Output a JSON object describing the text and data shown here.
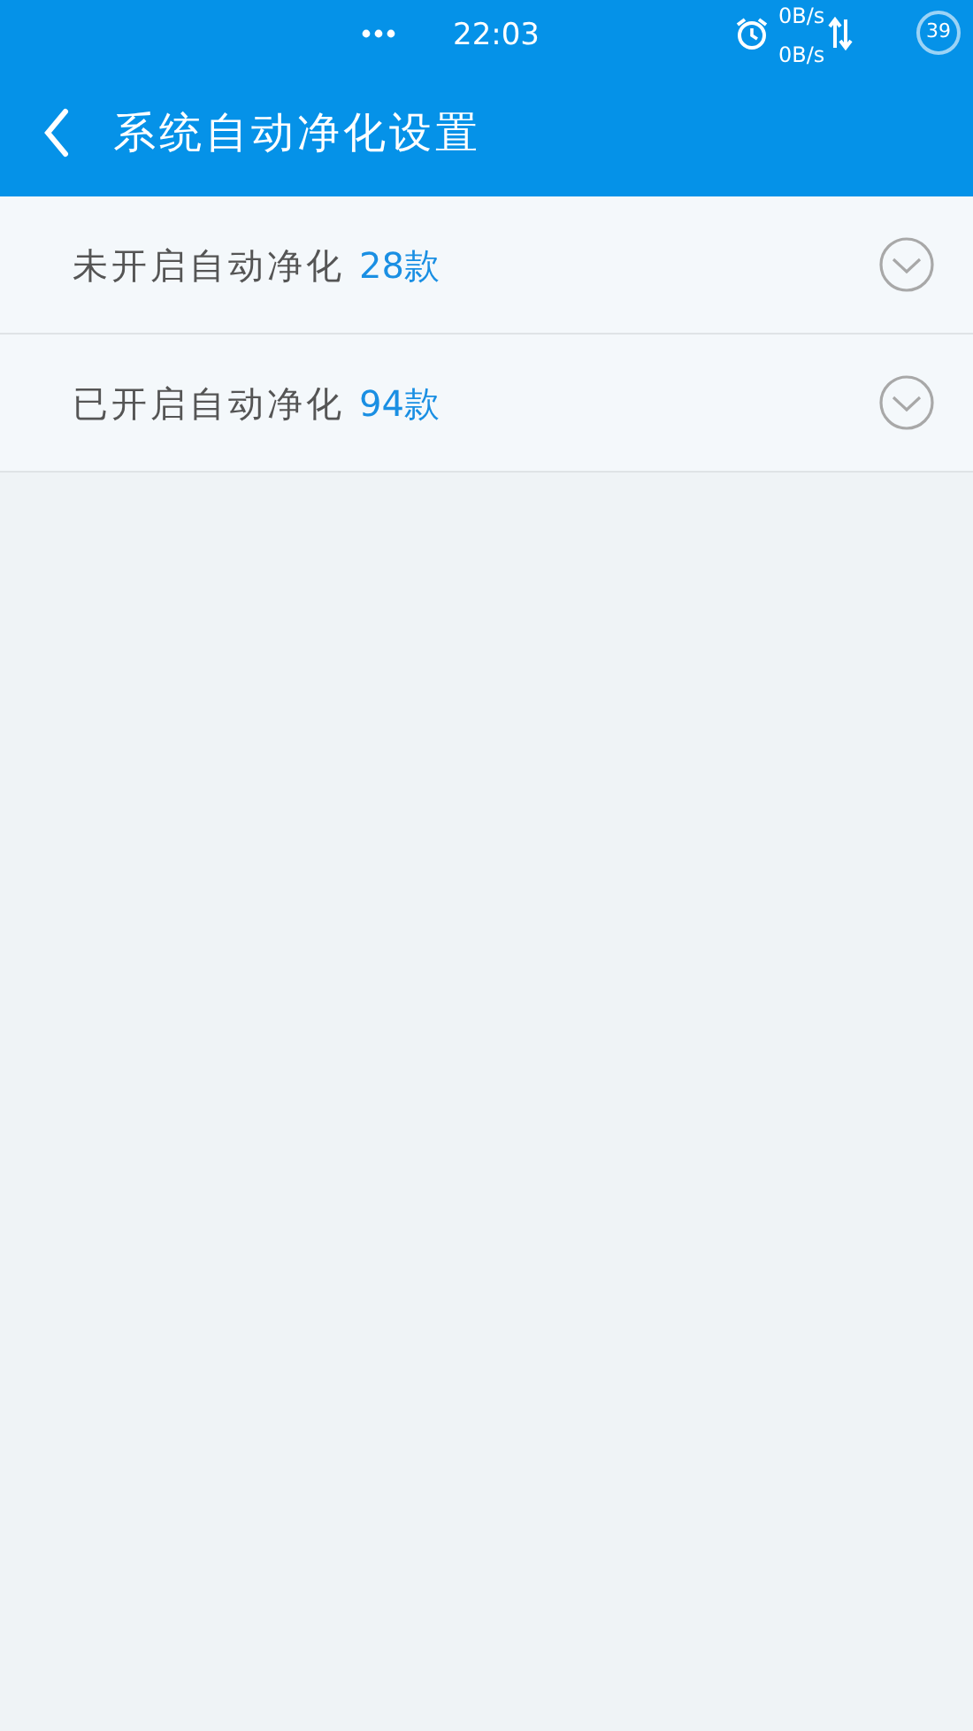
{
  "status_bar": {
    "time": "22:03",
    "upload_speed": "0B/s",
    "download_speed": "0B/s",
    "battery": "39"
  },
  "header": {
    "title": "系统自动净化设置"
  },
  "groups": [
    {
      "label": "未开启自动净化",
      "count": "28款",
      "expanded": false
    },
    {
      "label": "已开启自动净化",
      "count": "94款",
      "expanded": false
    }
  ]
}
